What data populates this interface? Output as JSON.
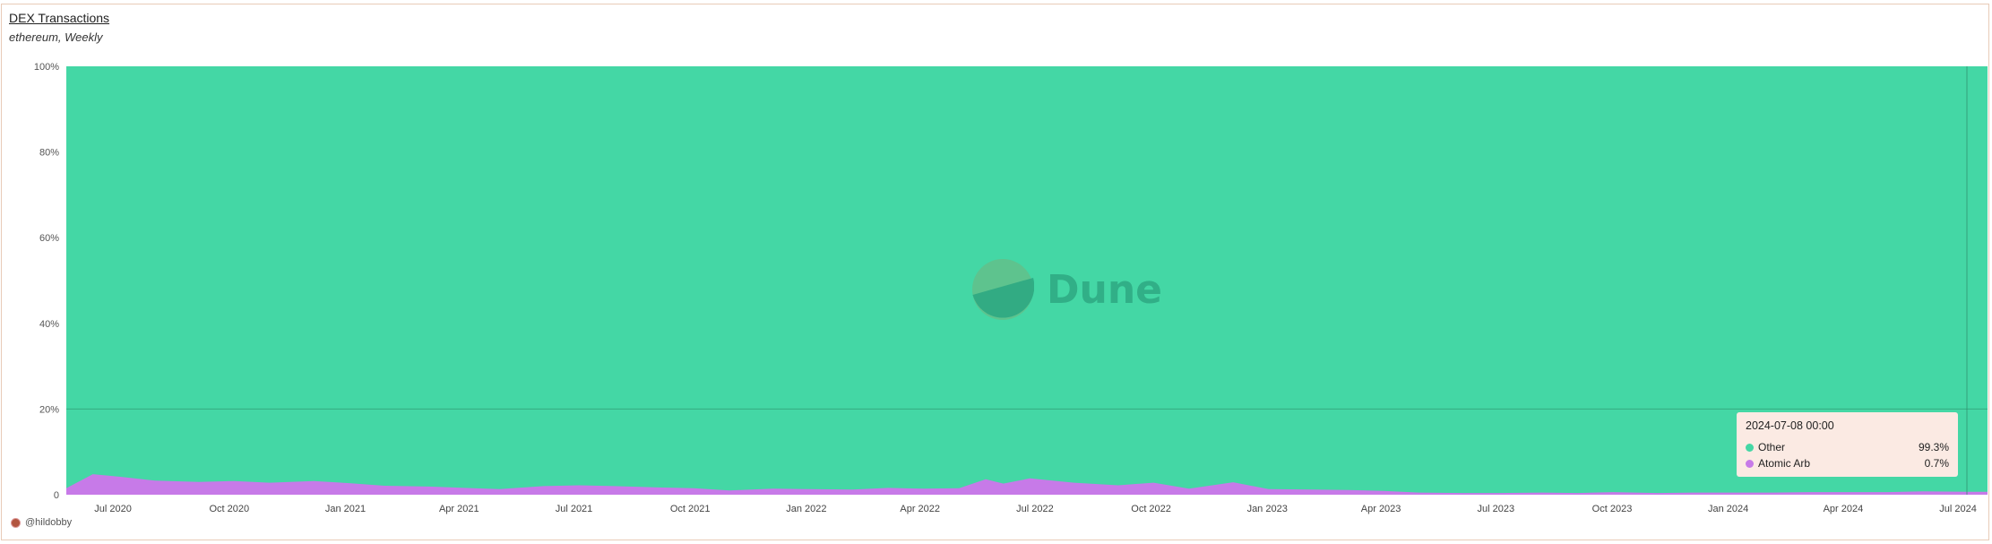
{
  "header": {
    "title": "DEX Transactions",
    "subtitle": "ethereum, Weekly"
  },
  "footer": {
    "author": "@hildobby"
  },
  "watermark": {
    "text": "Dune"
  },
  "tooltip": {
    "date": "2024-07-08 00:00",
    "rows": [
      {
        "name": "Other",
        "value": "99.3%",
        "color": "#44d7a5"
      },
      {
        "name": "Atomic Arb",
        "value": "0.7%",
        "color": "#c77ae8"
      }
    ]
  },
  "colors": {
    "other": "#44d7a5",
    "atomic_arb": "#c77ae8",
    "gridline": "#2e8c6a"
  },
  "chart_data": {
    "type": "area",
    "stacked": true,
    "normalized": true,
    "ylim": [
      0,
      100
    ],
    "y_ticks": [
      "0",
      "20%",
      "40%",
      "60%",
      "80%",
      "100%"
    ],
    "x_ticks": [
      "Jul 2020",
      "Oct 2020",
      "Jan 2021",
      "Apr 2021",
      "Jul 2021",
      "Oct 2021",
      "Jan 2022",
      "Apr 2022",
      "Jul 2022",
      "Oct 2022",
      "Jan 2023",
      "Apr 2023",
      "Jul 2023",
      "Oct 2023",
      "Jan 2024",
      "Apr 2024",
      "Jul 2024"
    ],
    "legend": "tooltip",
    "series": [
      {
        "name": "Atomic Arb",
        "x": [
          "2020-05-25",
          "2020-06-15",
          "2020-07-06",
          "2020-08-03",
          "2020-09-07",
          "2020-10-05",
          "2020-11-02",
          "2020-12-07",
          "2021-01-04",
          "2021-02-01",
          "2021-03-08",
          "2021-04-05",
          "2021-05-03",
          "2021-06-07",
          "2021-07-05",
          "2021-08-02",
          "2021-09-06",
          "2021-10-04",
          "2021-11-01",
          "2021-12-06",
          "2022-01-03",
          "2022-02-07",
          "2022-03-07",
          "2022-04-04",
          "2022-05-02",
          "2022-05-23",
          "2022-06-06",
          "2022-06-27",
          "2022-08-01",
          "2022-09-05",
          "2022-10-03",
          "2022-10-31",
          "2022-12-05",
          "2023-01-02",
          "2023-02-06",
          "2023-03-06",
          "2023-04-03",
          "2023-05-01",
          "2023-06-05",
          "2023-07-03",
          "2023-08-07",
          "2023-09-04",
          "2023-10-02",
          "2023-11-06",
          "2023-12-04",
          "2024-01-01",
          "2024-02-05",
          "2024-03-04",
          "2024-04-01",
          "2024-05-06",
          "2024-06-03",
          "2024-07-08"
        ],
        "values": [
          1.5,
          4.8,
          4.2,
          3.3,
          3.0,
          3.2,
          2.8,
          3.2,
          2.7,
          2.1,
          1.9,
          1.6,
          1.3,
          2.0,
          2.2,
          2.0,
          1.7,
          1.5,
          1.0,
          1.4,
          1.3,
          1.2,
          1.6,
          1.4,
          1.5,
          3.6,
          2.6,
          3.8,
          2.8,
          2.2,
          2.8,
          1.4,
          2.9,
          1.3,
          1.2,
          1.1,
          0.9,
          0.5,
          0.4,
          0.4,
          0.5,
          0.4,
          0.6,
          0.4,
          0.5,
          0.5,
          0.5,
          0.6,
          0.6,
          0.6,
          0.8,
          0.7
        ]
      },
      {
        "name": "Other",
        "x": [
          "2020-05-25",
          "2024-07-08"
        ],
        "values": "remainder to 100%"
      }
    ]
  }
}
